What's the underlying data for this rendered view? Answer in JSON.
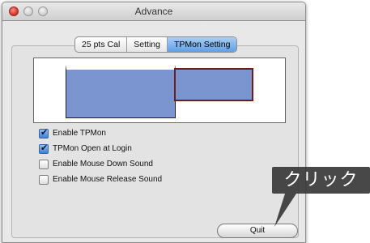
{
  "window": {
    "title": "Advance"
  },
  "tabs": [
    {
      "label": "25 pts Cal"
    },
    {
      "label": "Setting"
    },
    {
      "label": "TPMon Setting",
      "active": true
    }
  ],
  "options": [
    {
      "label": "Enable TPMon",
      "checked": true
    },
    {
      "label": "TPMon Open at Login",
      "checked": true
    },
    {
      "label": "Enable Mouse Down Sound",
      "checked": false
    },
    {
      "label": "Enable Mouse Release Sound",
      "checked": false
    }
  ],
  "quit_label": "Quit",
  "annotation": {
    "text": "クリック"
  },
  "colors": {
    "monitor_fill": "#7a95d0",
    "selected_border": "#6b1e1e",
    "tab_active": "#5f9ee6"
  }
}
